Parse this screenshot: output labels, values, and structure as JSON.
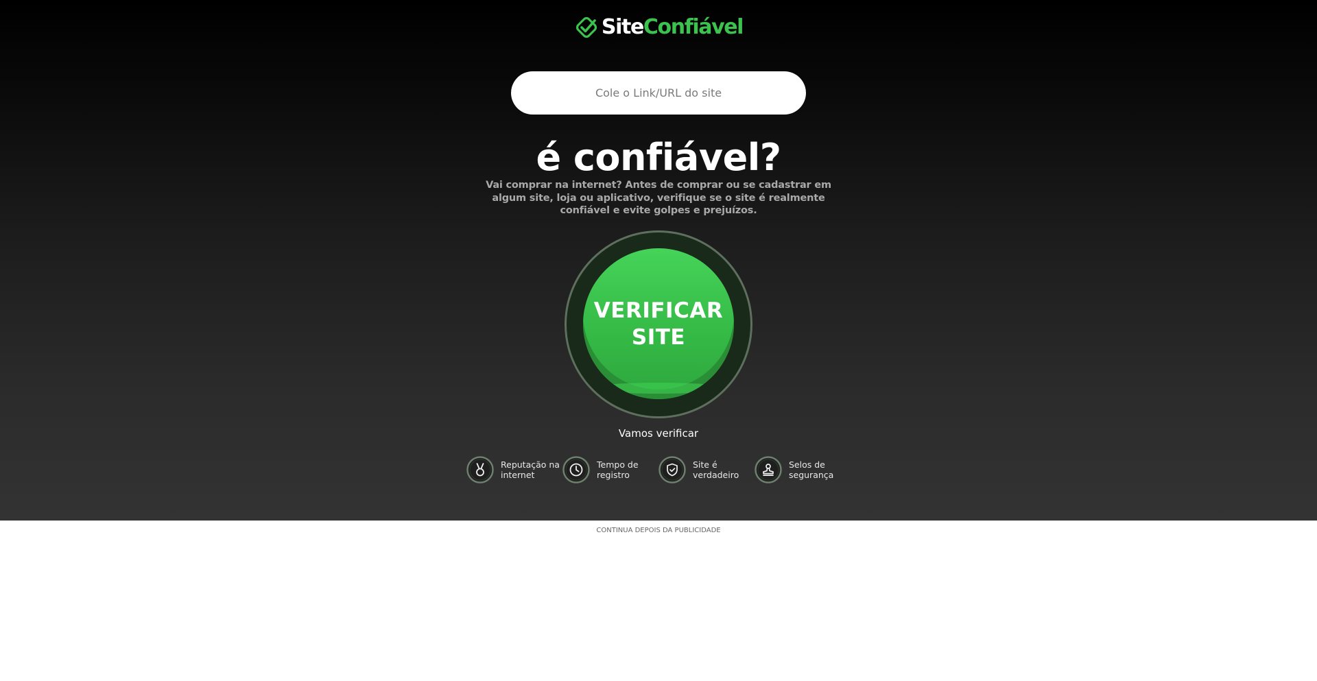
{
  "brand": {
    "name_part1": "Site",
    "name_part2": "Confiável",
    "accent_color": "#3cc24f"
  },
  "search": {
    "placeholder": "Cole o Link/URL do site",
    "value": ""
  },
  "hero": {
    "headline": "é confiável?",
    "subtitle": "Vai comprar na internet? Antes de comprar ou se cadastrar em algum site, loja ou aplicativo, verifique se o site é realmente confiável e evite golpes e prejuízos."
  },
  "verify": {
    "line1": "VERIFICAR",
    "line2": "SITE",
    "caption": "Vamos verificar",
    "button_color": "#3cc24f"
  },
  "features": [
    {
      "icon": "medal-icon",
      "line1": "Reputação na",
      "line2": "internet"
    },
    {
      "icon": "clock-icon",
      "line1": "Tempo de",
      "line2": "registro"
    },
    {
      "icon": "shield-check-icon",
      "line1": "Site é",
      "line2": "verdadeiro"
    },
    {
      "icon": "stamp-icon",
      "line1": "Selos de",
      "line2": "segurança"
    }
  ],
  "ad": {
    "notice": "CONTINUA DEPOIS DA PUBLICIDADE"
  }
}
